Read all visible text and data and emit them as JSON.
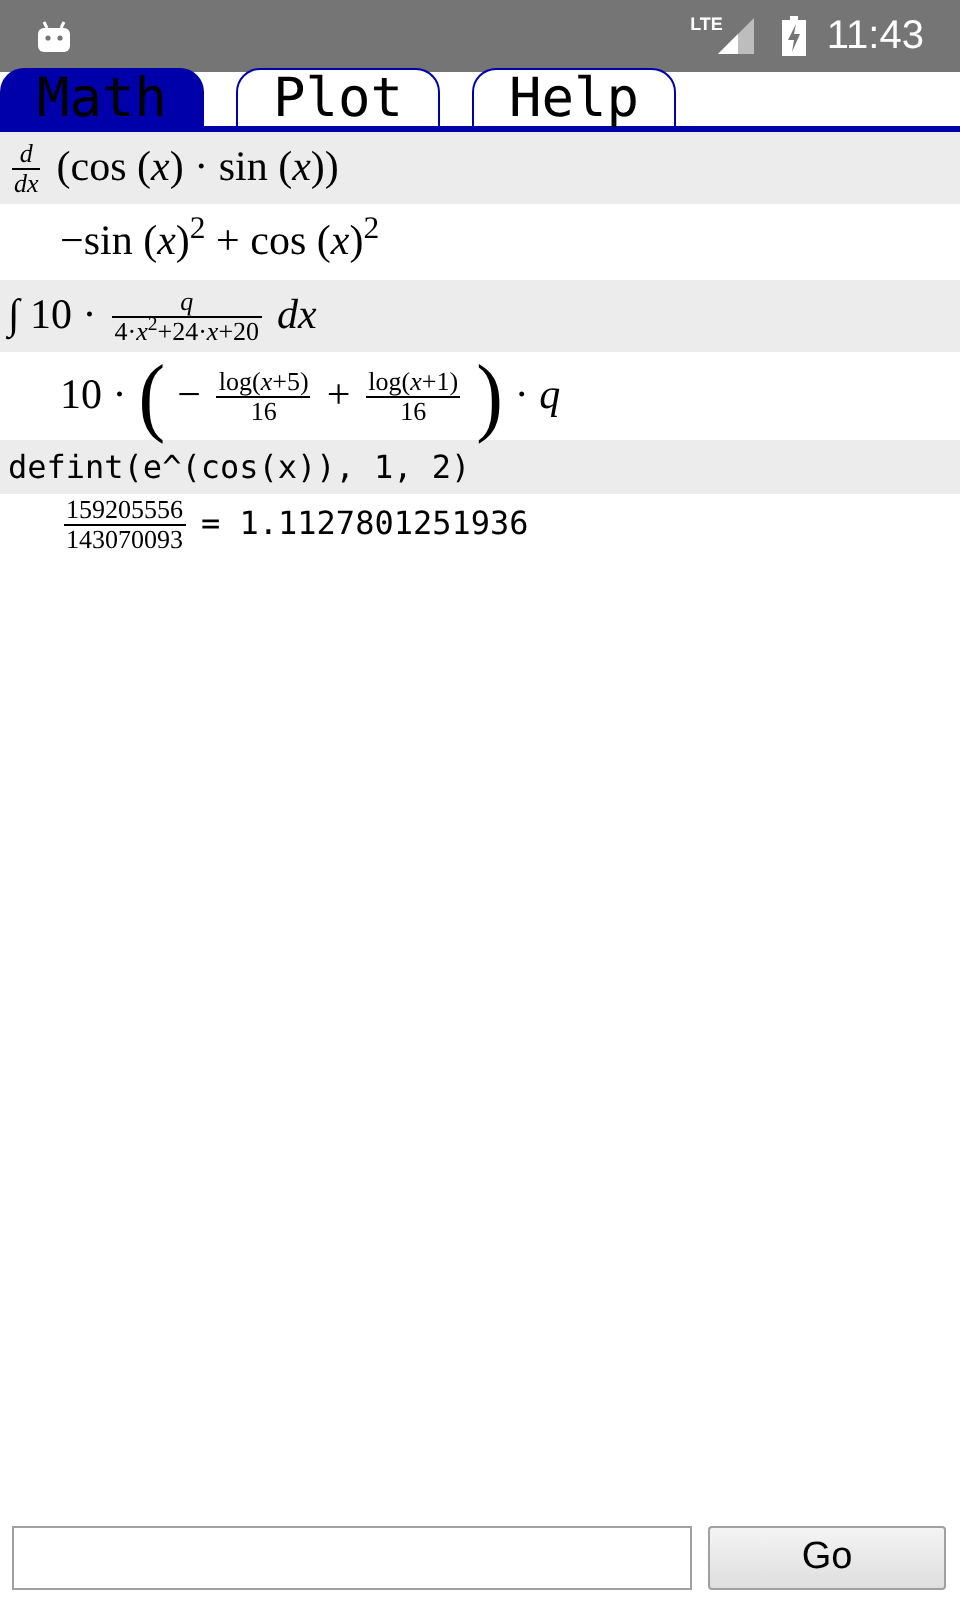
{
  "status_bar": {
    "network": "LTE",
    "time": "11:43"
  },
  "tabs": [
    {
      "label": "Math",
      "selected": true
    },
    {
      "label": "Plot",
      "selected": false
    },
    {
      "label": "Help",
      "selected": false
    }
  ],
  "entries": [
    {
      "input": [
        {
          "kind": "frac",
          "num": "*d*",
          "den": "*dx*"
        },
        {
          "kind": "text",
          "text": "(cos (*x*) · sin (*x*))"
        }
      ],
      "output": [
        {
          "kind": "text",
          "text": "−sin (*x*)$^{2}$ + cos (*x*)$^{2}$"
        }
      ]
    },
    {
      "input": [
        {
          "kind": "text",
          "text": "∫ 10 ·"
        },
        {
          "kind": "frac",
          "num": "*q*",
          "den": "4·*x*$^{2}$+24·*x*+20"
        },
        {
          "kind": "text",
          "text": "*dx*"
        }
      ],
      "output": [
        {
          "kind": "text",
          "text": "10 ·"
        },
        {
          "kind": "paren",
          "text": "("
        },
        {
          "kind": "text",
          "text": "−"
        },
        {
          "kind": "frac",
          "num": "log(*x*+5)",
          "den": "16"
        },
        {
          "kind": "text",
          "text": "+"
        },
        {
          "kind": "frac",
          "num": "log(*x*+1)",
          "den": "16"
        },
        {
          "kind": "paren",
          "text": ")"
        },
        {
          "kind": "text",
          "text": "· *q*"
        }
      ]
    },
    {
      "input": [
        {
          "kind": "code",
          "text": "defint(e^(cos(x)), 1, 2)"
        }
      ],
      "output": [
        {
          "kind": "frac",
          "num": "159205556",
          "den": "143070093"
        },
        {
          "kind": "code",
          "text": "= 1.1127801251936"
        }
      ]
    }
  ],
  "command": {
    "button": "Go"
  }
}
